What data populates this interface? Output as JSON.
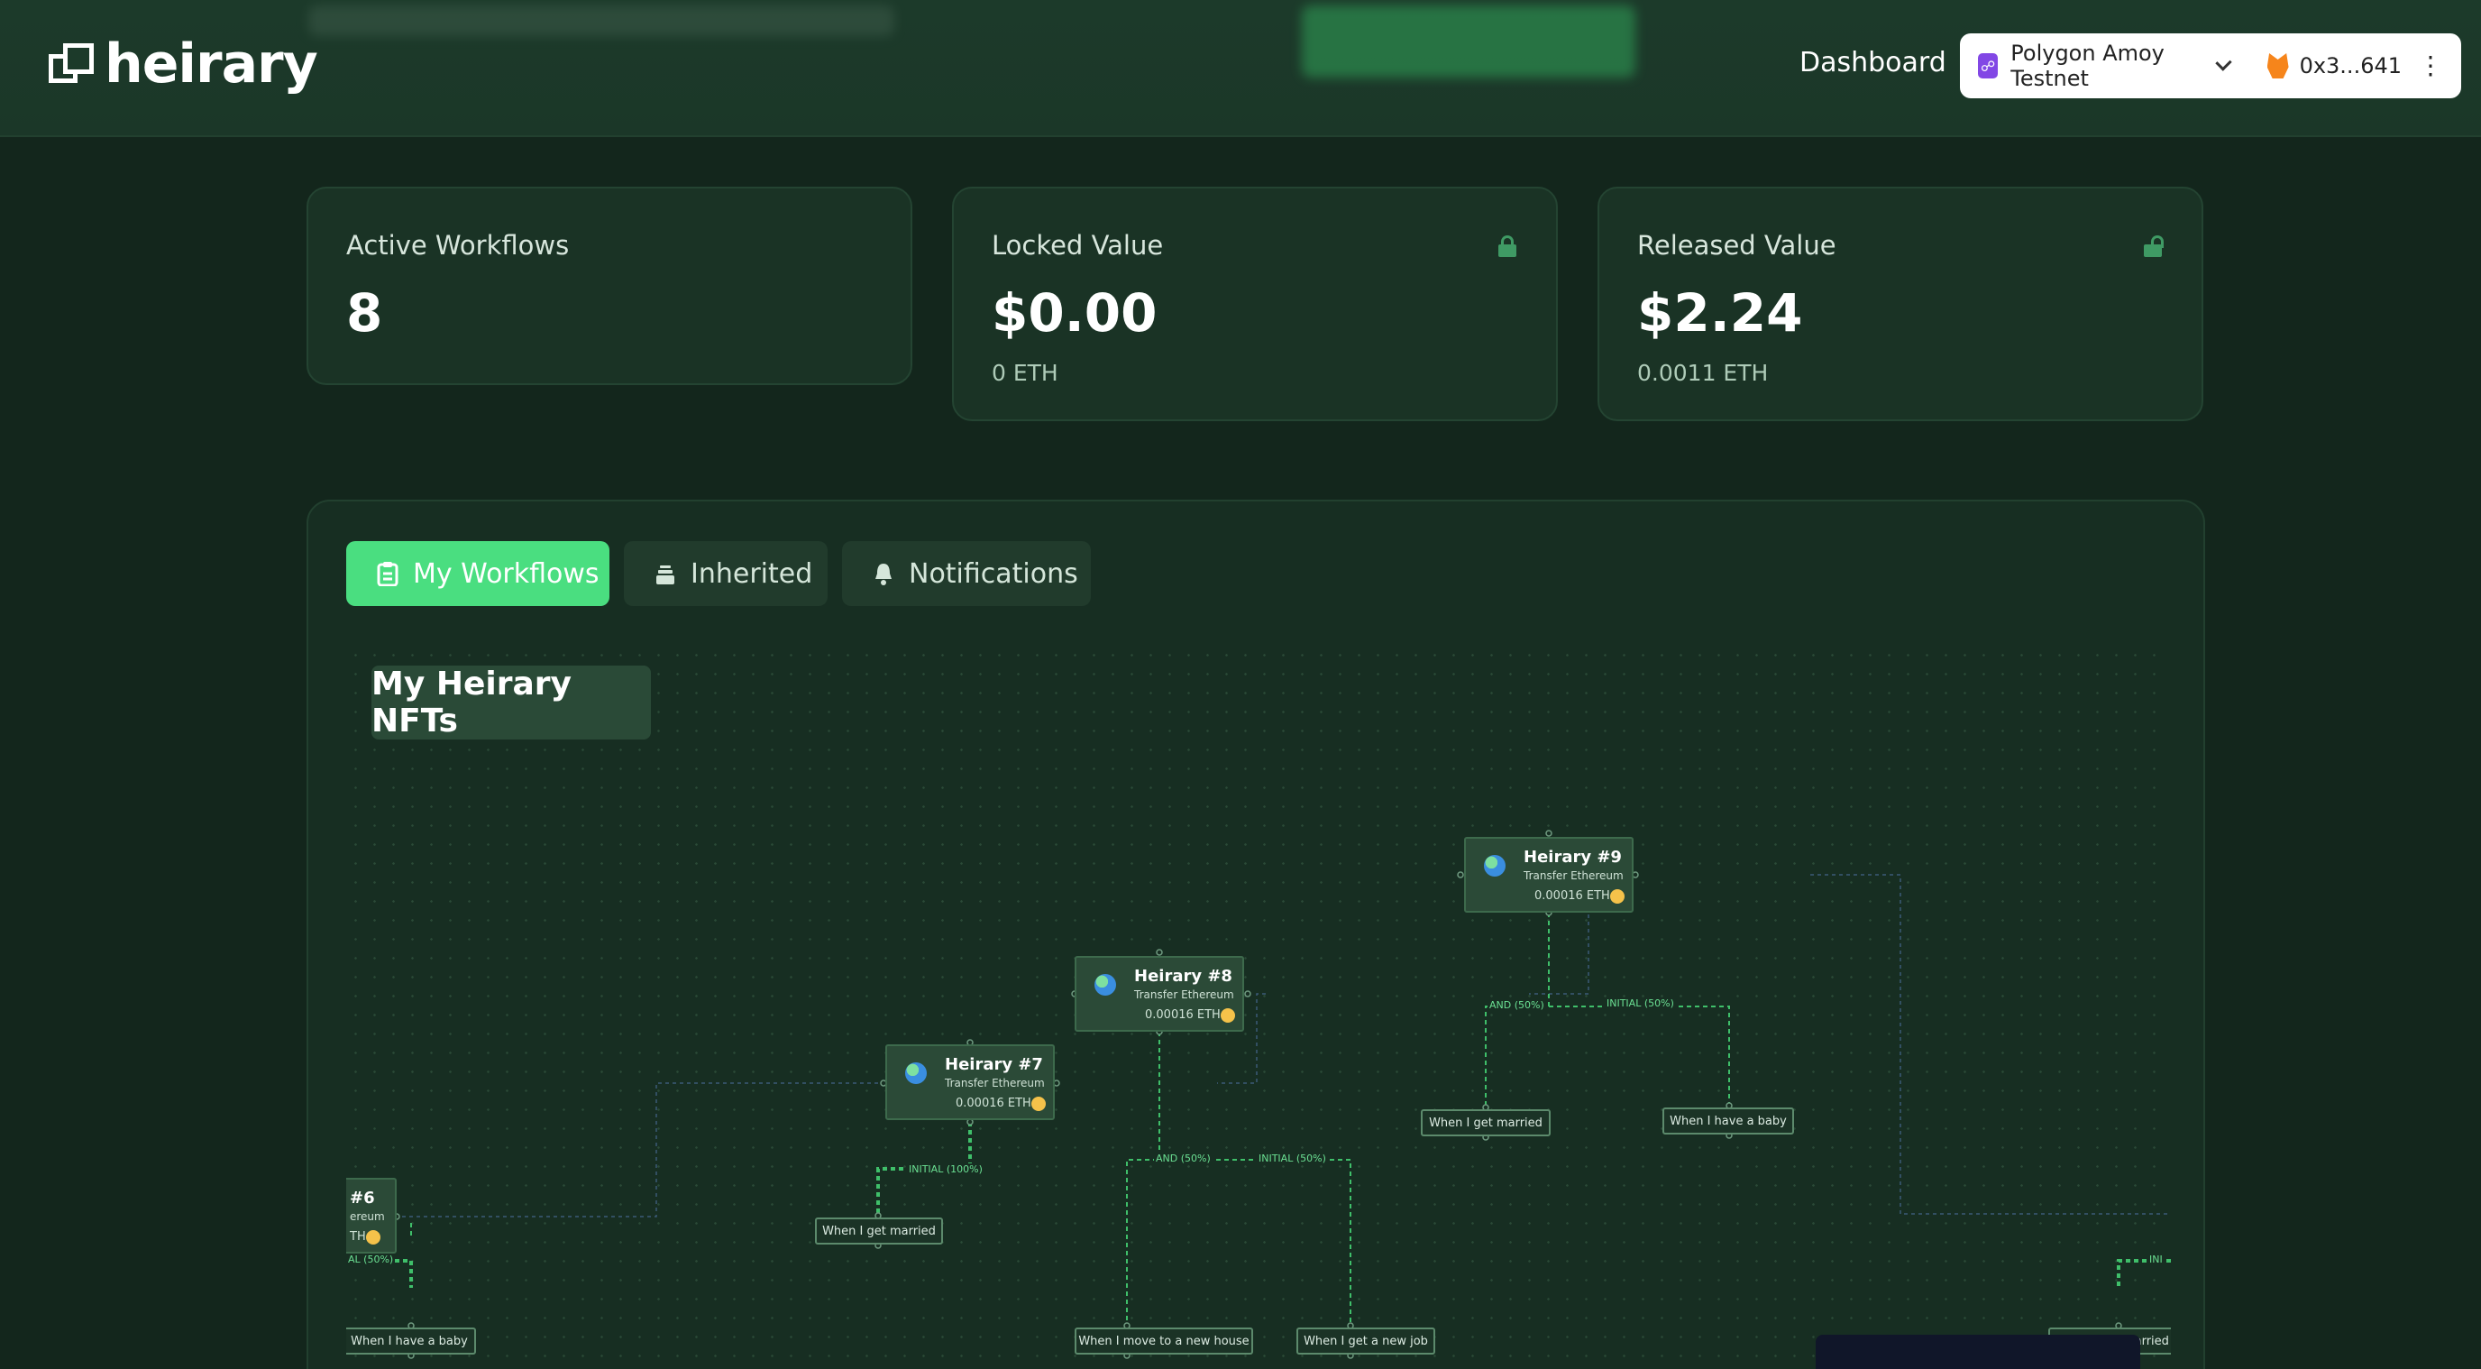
{
  "header": {
    "logo_text": "heirary",
    "nav_dashboard": "Dashboard",
    "network_label": "Polygon Amoy Testnet",
    "network_icon": "chain-link-icon",
    "wallet_address": "0x3...641",
    "wallet_icon": "metamask-fox-icon"
  },
  "stats": {
    "active": {
      "label": "Active Workflows",
      "value": "8"
    },
    "locked": {
      "label": "Locked Value",
      "value": "$0.00",
      "sub": "0 ETH"
    },
    "released": {
      "label": "Released Value",
      "value": "$2.24",
      "sub": "0.0011 ETH"
    }
  },
  "tabs": [
    {
      "label": "My Workflows",
      "icon": "clipboard-icon",
      "active": true
    },
    {
      "label": "Inherited",
      "icon": "stack-icon",
      "active": false
    },
    {
      "label": "Notifications",
      "icon": "bell-icon",
      "active": false
    }
  ],
  "flow": {
    "title": "My Heirary NFTs",
    "nodes": [
      {
        "title": "Heirary #9",
        "subtitle": "Transfer Ethereum",
        "amount": "0.00016 ETH"
      },
      {
        "title": "Heirary #8",
        "subtitle": "Transfer Ethereum",
        "amount": "0.00016 ETH"
      },
      {
        "title": "Heirary #7",
        "subtitle": "Transfer Ethereum",
        "amount": "0.00016 ETH"
      },
      {
        "title": "#6",
        "subtitle": "ereum",
        "amount": "TH"
      }
    ],
    "conditions": [
      "When I get married",
      "When I have a baby",
      "When I get married",
      "When I move to a new house",
      "When I get a new job",
      "When I have a baby",
      "When I get married"
    ],
    "edge_labels": [
      "AND (50%)",
      "INITIAL (50%)",
      "AND (50%)",
      "INITIAL (50%)",
      "INITIAL (100%)",
      "AL (50%)",
      "INI"
    ]
  },
  "colors": {
    "accent": "#4ade80",
    "background": "#13261c",
    "card": "#1a3325",
    "edge": "#3fbf6a"
  }
}
